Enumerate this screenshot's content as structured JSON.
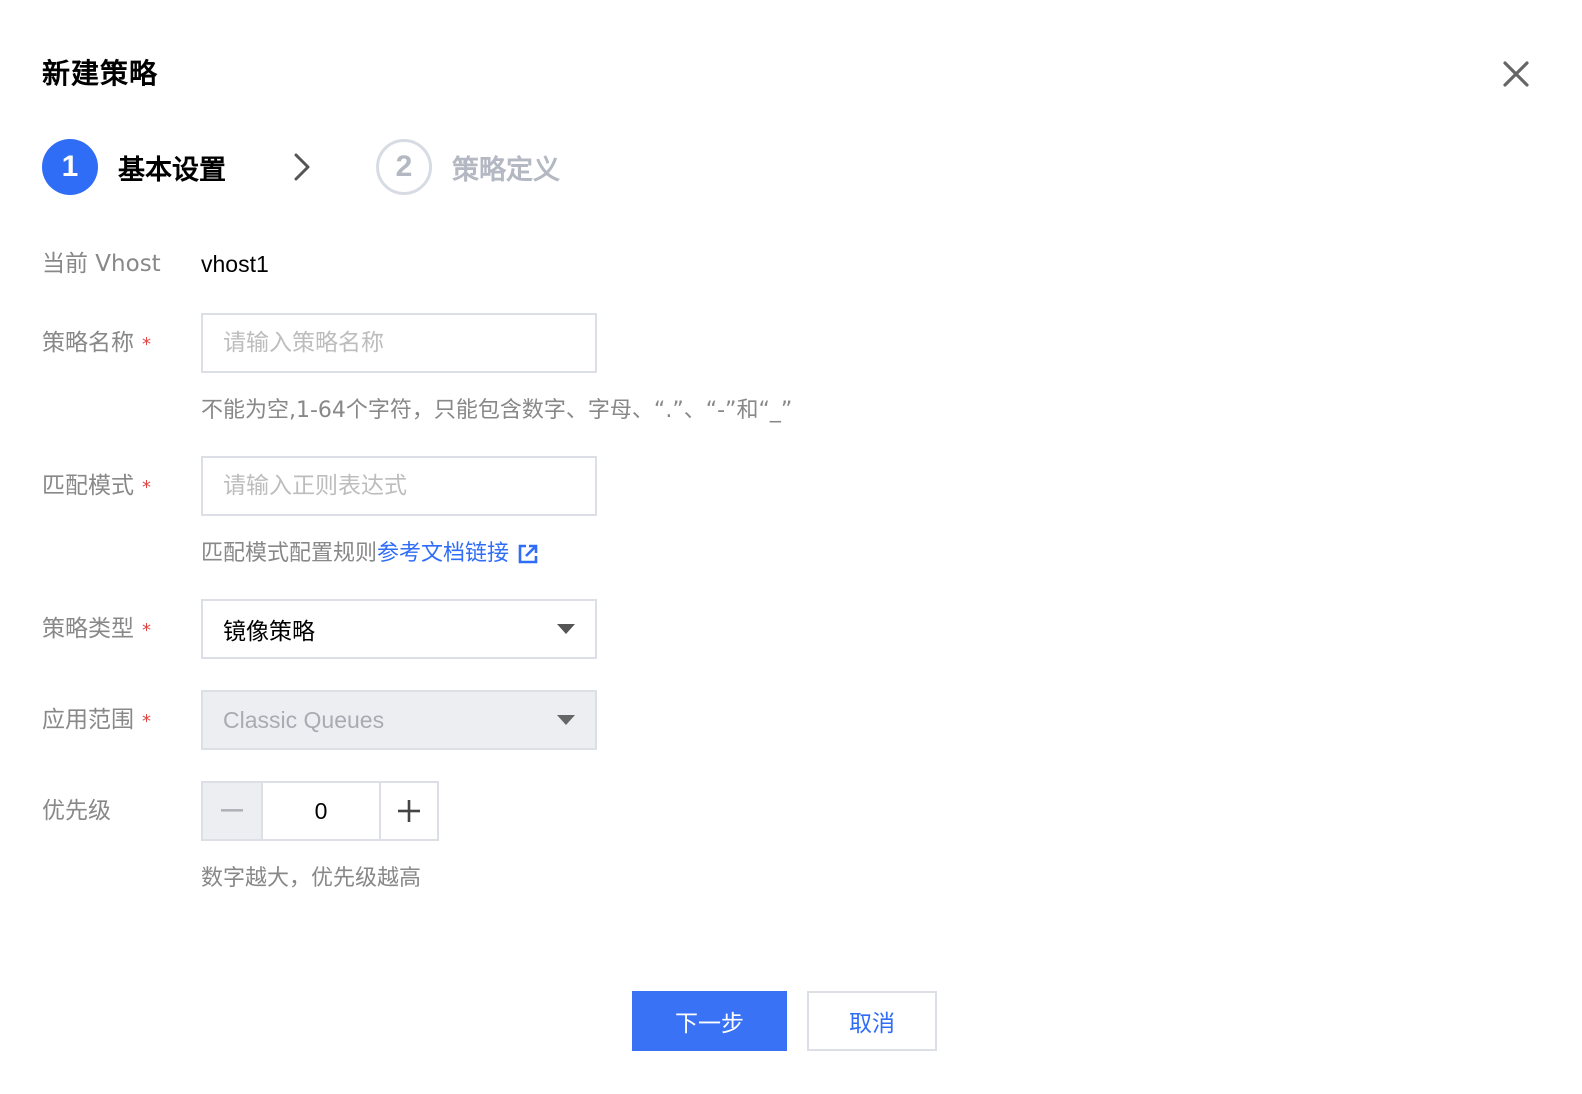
{
  "dialog": {
    "title": "新建策略"
  },
  "steps": [
    {
      "number": "1",
      "label": "基本设置",
      "state": "active"
    },
    {
      "number": "2",
      "label": "策略定义",
      "state": "inactive"
    }
  ],
  "form": {
    "vhost": {
      "label": "当前 Vhost",
      "value": "vhost1"
    },
    "policy_name": {
      "label": "策略名称",
      "required_mark": "*",
      "placeholder": "请输入策略名称",
      "value": "",
      "help": "不能为空,1-64个字符，只能包含数字、字母、“.”、“-”和“_”"
    },
    "match_pattern": {
      "label": "匹配模式",
      "required_mark": "*",
      "placeholder": "请输入正则表达式",
      "value": "",
      "help_prefix": "匹配模式配置规则",
      "help_link": "参考文档链接"
    },
    "policy_type": {
      "label": "策略类型",
      "required_mark": "*",
      "selected": "镜像策略"
    },
    "apply_scope": {
      "label": "应用范围",
      "required_mark": "*",
      "selected": "Classic Queues",
      "disabled": true
    },
    "priority": {
      "label": "优先级",
      "value": "0",
      "help": "数字越大，优先级越高"
    }
  },
  "footer": {
    "next_label": "下一步",
    "cancel_label": "取消"
  },
  "colors": {
    "primary": "#2f6df6",
    "required": "#e54545",
    "muted_text": "#888888",
    "disabled_bg": "#eceef2"
  }
}
